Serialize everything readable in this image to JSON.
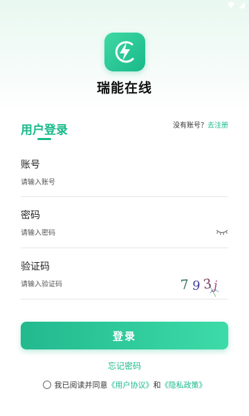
{
  "app": {
    "name": "瑞能在线"
  },
  "login": {
    "title": "用户登录",
    "no_account_text": "没有账号？",
    "register_link": "去注册"
  },
  "fields": {
    "account": {
      "label": "账号",
      "placeholder": "请输入账号",
      "value": ""
    },
    "password": {
      "label": "密码",
      "placeholder": "请输入密码",
      "value": ""
    },
    "captcha": {
      "label": "验证码",
      "placeholder": "请输入验证码",
      "value": "",
      "image_text": "793j"
    }
  },
  "buttons": {
    "login": "登录",
    "forgot_password": "忘记密码"
  },
  "agreement": {
    "prefix": "我已阅读并同意",
    "user_agreement": "《用户协议》",
    "and": "和",
    "privacy_policy": "《隐私政策》",
    "checked": false
  },
  "colors": {
    "accent": "#19b98a",
    "button_gradient_start": "#22b98e",
    "button_gradient_end": "#3ddba8"
  },
  "icons": {
    "logo": "lightning-bolt-icon",
    "password_visibility": "eye-closed-icon",
    "wifi": "wifi-icon",
    "signal": "signal-icon"
  }
}
